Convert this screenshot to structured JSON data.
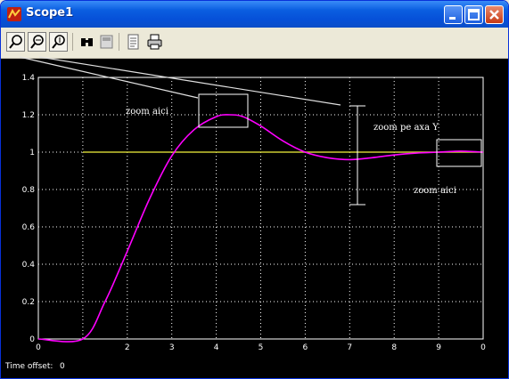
{
  "window": {
    "title": "Scope1"
  },
  "toolbar": {
    "buttons": [
      {
        "name": "zoom-in-icon"
      },
      {
        "name": "zoom-x-icon"
      },
      {
        "name": "zoom-y-icon"
      },
      {
        "name": "autoscale-icon"
      },
      {
        "name": "save-axes-icon"
      },
      {
        "name": "params-icon"
      },
      {
        "name": "print-icon"
      }
    ]
  },
  "status": {
    "label": "Time offset:",
    "value": "0"
  },
  "annotations": {
    "zoom_top": "zoom aici",
    "zoom_y": "zoom pe axa Y",
    "zoom_right": "zoom aici"
  },
  "colors": {
    "response": "#ff00ff",
    "reference": "#cccc33",
    "grid": "#ffffff"
  },
  "chart_data": {
    "type": "line",
    "xlim": [
      0,
      10
    ],
    "ylim": [
      0,
      1.4
    ],
    "x_tick_labels": [
      "0",
      "",
      "2",
      "3",
      "4",
      "5",
      "6",
      "7",
      "8",
      "9",
      "0"
    ],
    "y_tick_labels": [
      "0",
      "0.2",
      "0.4",
      "0.6",
      "0.8",
      "1",
      "1.2",
      "1.4"
    ],
    "grid": true,
    "series": [
      {
        "values": [
          [
            0,
            0
          ],
          [
            1,
            0
          ],
          [
            1.5,
            0.2
          ],
          [
            2,
            0.47
          ],
          [
            2.5,
            0.75
          ],
          [
            3,
            0.98
          ],
          [
            3.5,
            1.12
          ],
          [
            4,
            1.19
          ],
          [
            4.3,
            1.2
          ],
          [
            4.6,
            1.19
          ],
          [
            5,
            1.14
          ],
          [
            5.5,
            1.06
          ],
          [
            6,
            1.0
          ],
          [
            6.5,
            0.97
          ],
          [
            7,
            0.96
          ],
          [
            7.5,
            0.97
          ],
          [
            8,
            0.985
          ],
          [
            8.5,
            0.995
          ],
          [
            9,
            1.0
          ],
          [
            9.5,
            1.005
          ],
          [
            10,
            1.0
          ]
        ]
      },
      {
        "values": [
          [
            1,
            1
          ],
          [
            10,
            1
          ]
        ]
      }
    ]
  }
}
